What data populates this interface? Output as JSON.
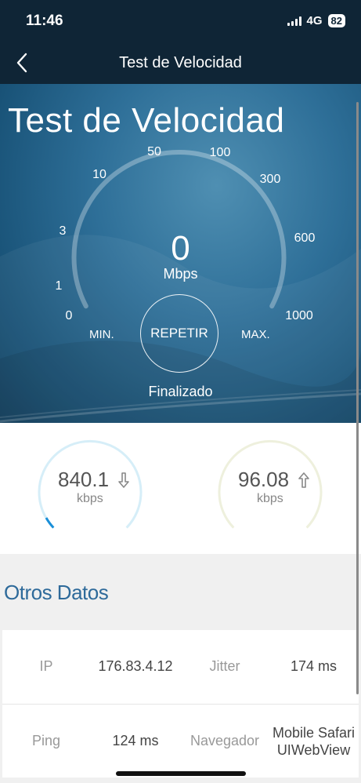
{
  "status_bar": {
    "time": "11:46",
    "network": "4G",
    "battery": "82"
  },
  "nav": {
    "title": "Test de Velocidad"
  },
  "hero": {
    "title": "Test de Velocidad",
    "gauge_ticks": [
      "0",
      "1",
      "3",
      "10",
      "50",
      "100",
      "300",
      "600",
      "1000"
    ],
    "speed_value": "0",
    "speed_unit": "Mbps",
    "min_label": "MIN.",
    "max_label": "MAX.",
    "repeat_button": "REPETIR",
    "status": "Finalizado",
    "speed_level": 0
  },
  "results": {
    "download": {
      "value": "840.1",
      "unit": "kbps",
      "color": "#1a8fd8",
      "arc_color": "#d6eef8"
    },
    "upload": {
      "value": "96.08",
      "unit": "kbps",
      "color": "#5cc24a",
      "arc_color": "#eef0dd"
    }
  },
  "otros": {
    "heading": "Otros Datos",
    "rows": [
      {
        "label1": "IP",
        "value1": "176.83.4.12",
        "label2": "Jitter",
        "value2": "174 ms"
      },
      {
        "label1": "Ping",
        "value1": "124 ms",
        "label2": "Navegador",
        "value2": "Mobile Safari UIWebView"
      }
    ]
  },
  "icons": {
    "back": "chevron-left-icon",
    "download": "arrow-down-icon",
    "upload": "arrow-up-icon",
    "signal": "signal-bars-icon",
    "battery": "battery-icon"
  }
}
